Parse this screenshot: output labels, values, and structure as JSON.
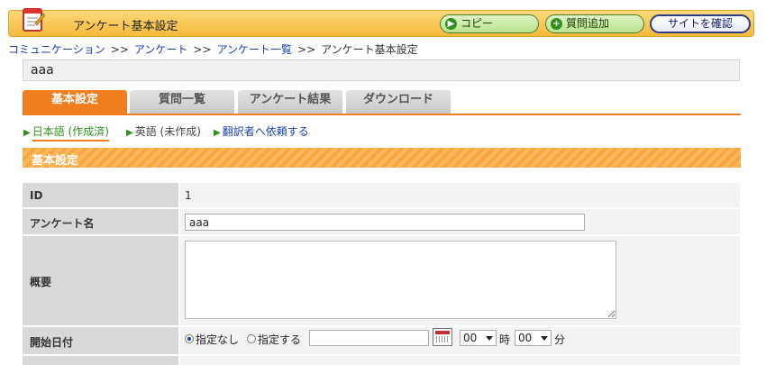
{
  "header": {
    "title": "アンケート基本設定",
    "copy_label": "コピー",
    "add_question_label": "質問追加",
    "check_site_label": "サイトを確認"
  },
  "breadcrumb": {
    "items": [
      "コミュニケーション",
      "アンケート",
      "アンケート一覧",
      "アンケート基本設定"
    ],
    "separator": ">>"
  },
  "survey_name": "aaa",
  "tabs": [
    "基本設定",
    "質問一覧",
    "アンケート結果",
    "ダウンロード"
  ],
  "active_tab": "基本設定",
  "languages": {
    "japanese": "日本語 (作成済)",
    "english": "英語 (未作成)",
    "request": "翻訳者へ依頼する"
  },
  "section_title": "基本設定",
  "form": {
    "id_label": "ID",
    "id_value": "1",
    "name_label": "アンケート名",
    "name_value": "aaa",
    "summary_label": "概要",
    "summary_value": "",
    "start_label": "開始日付",
    "start_option_none": "指定なし",
    "start_option_specify": "指定する",
    "hour_value": "00",
    "hour_unit": "時",
    "minute_value": "00",
    "minute_unit": "分"
  },
  "colors": {
    "accent": "#f07d1e",
    "header_bg": "#f6b93a",
    "link": "#1a3fb0",
    "current_lang": "#2f8f1f"
  }
}
